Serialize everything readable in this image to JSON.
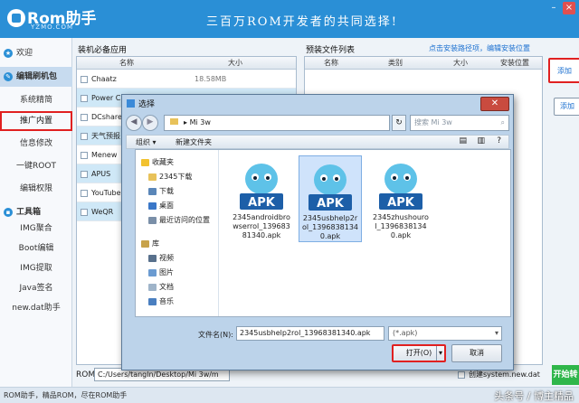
{
  "app": {
    "logo_main": "Rom助手",
    "logo_sub": "YZMO.COM",
    "slogan": "三百万ROM开发者的共同选择!"
  },
  "sidebar": {
    "items": [
      "欢迎",
      "编辑刷机包",
      "系统精简",
      "推广内置",
      "信息修改",
      "一键ROOT",
      "编辑权限"
    ],
    "tools_header": "工具箱",
    "tools": [
      "IMG聚合",
      "Boot编辑",
      "IMG提取",
      "Java签名",
      "new.dat助手"
    ]
  },
  "apps_panel": {
    "title": "装机必备应用",
    "col_name": "名称",
    "col_size": "大小",
    "rows": [
      {
        "name": "Chaatz",
        "size": "18.58MB"
      },
      {
        "name": "Power Cl",
        "size": ""
      },
      {
        "name": "DCshare",
        "size": ""
      },
      {
        "name": "天气预报",
        "size": ""
      },
      {
        "name": "Menew",
        "size": ""
      },
      {
        "name": "APUS",
        "size": ""
      },
      {
        "name": "YouTube",
        "size": ""
      },
      {
        "name": "WeQR",
        "size": ""
      }
    ]
  },
  "preinstall_panel": {
    "title": "预装文件列表",
    "link_path": "点击安装路径项，编辑安装位置",
    "col_name": "名称",
    "col_type": "类别",
    "col_size": "大小",
    "col_location": "安装位置"
  },
  "right_buttons": {
    "add_label": "添加",
    "add_label2": "添加"
  },
  "bottom": {
    "rom_label": "ROM",
    "rom_path": "C:/Users/tangln/Desktop/Mi 3w/m",
    "create_label": "创建system.new.dat",
    "start_label": "开始转",
    "footer": "ROM助手，精品ROM，尽在ROM助手",
    "watermark": "头条号 / 博主精品"
  },
  "dialog": {
    "title": "选择",
    "path": "Mi 3w",
    "search_placeholder": "搜索 Mi 3w",
    "organize": "组织 ▾",
    "new_folder": "新建文件夹",
    "tree": [
      {
        "label": "收藏夹",
        "icon": "star-icon"
      },
      {
        "label": "2345下载",
        "icon": "folder-icon"
      },
      {
        "label": "下载",
        "icon": "download-folder-icon"
      },
      {
        "label": "桌面",
        "icon": "desktop-icon"
      },
      {
        "label": "最近访问的位置",
        "icon": "recent-icon"
      },
      {
        "label": "库",
        "icon": "library-icon"
      },
      {
        "label": "视频",
        "icon": "video-icon"
      },
      {
        "label": "图片",
        "icon": "picture-icon"
      },
      {
        "label": "文档",
        "icon": "document-icon"
      },
      {
        "label": "音乐",
        "icon": "music-icon"
      }
    ],
    "files": [
      {
        "badge": "APK",
        "name": "2345androidbrowserrol_13968381340.apk"
      },
      {
        "badge": "APK",
        "name": "2345usbhelp2rol_13968381340.apk"
      },
      {
        "badge": "APK",
        "name": "2345zhushourol_13968381340.apk"
      }
    ],
    "filename_label": "文件名(N):",
    "filename_value": "2345usbhelp2rol_13968381340.apk",
    "filter_value": "(*.apk)",
    "open_label": "打开(O)",
    "cancel_label": "取消"
  }
}
